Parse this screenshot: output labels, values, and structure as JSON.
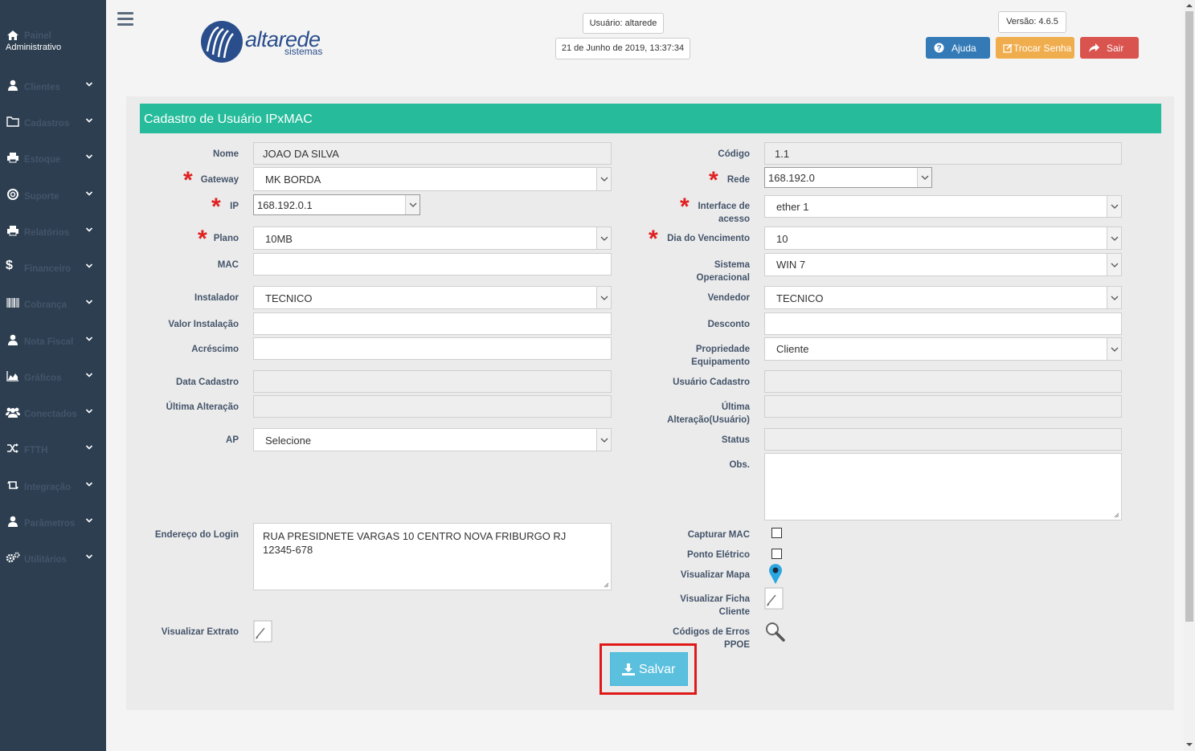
{
  "sidebar": {
    "home": {
      "line1": "Painel",
      "line2": "Administrativo"
    },
    "items": [
      {
        "label": "Clientes",
        "icon": "user-icon"
      },
      {
        "label": "Cadastros",
        "icon": "folder-icon"
      },
      {
        "label": "Estoque",
        "icon": "printer-icon"
      },
      {
        "label": "Suporte",
        "icon": "lifebuoy-icon"
      },
      {
        "label": "Relatórios",
        "icon": "printer-icon"
      },
      {
        "label": "Financeiro",
        "icon": "dollar-icon"
      },
      {
        "label": "Cobrança",
        "icon": "barcode-icon"
      },
      {
        "label": "Nota Fiscal",
        "icon": "user-icon"
      },
      {
        "label": "Gráficos",
        "icon": "area-chart-icon"
      },
      {
        "label": "Conectados",
        "icon": "users-icon"
      },
      {
        "label": "FTTH",
        "icon": "random-icon"
      },
      {
        "label": "Integração",
        "icon": "retweet-icon"
      },
      {
        "label": "Parâmetros",
        "icon": "user-icon"
      },
      {
        "label": "Utilitários",
        "icon": "cogs-icon"
      }
    ]
  },
  "header": {
    "logo_text": "altarede",
    "logo_sub": "sistemas",
    "user": "Usuário: altarede",
    "datetime": "21 de Junho de 2019, 13:37:34",
    "version": "Versão: 4.6.5",
    "help_label": "Ajuda",
    "change_pwd_label": "Trocar Senha",
    "logout_label": "Sair",
    "colors": {
      "help": "#337ab7",
      "change_pwd": "#f0ad4e",
      "logout": "#d9534f"
    }
  },
  "form": {
    "title": "Cadastro de Usuário IPxMAC",
    "nome": {
      "label": "Nome",
      "value": "JOAO DA SILVA"
    },
    "codigo": {
      "label": "Código",
      "value": "1.1"
    },
    "gateway": {
      "label": "Gateway",
      "value": "MK BORDA"
    },
    "rede": {
      "label": "Rede",
      "value": "168.192.0"
    },
    "ip": {
      "label": "IP",
      "value": "168.192.0.1"
    },
    "interface": {
      "label1": "Interface de",
      "label2": "acesso",
      "value": "ether 1"
    },
    "plano": {
      "label": "Plano",
      "value": "10MB"
    },
    "vencimento": {
      "label": "Dia do Vencimento",
      "value": "10"
    },
    "mac": {
      "label": "MAC",
      "value": ""
    },
    "so": {
      "label1": "Sistema",
      "label2": "Operacional",
      "value": "WIN 7"
    },
    "instalador": {
      "label": "Instalador",
      "value": "TECNICO"
    },
    "vendedor": {
      "label": "Vendedor",
      "value": "TECNICO"
    },
    "valor_instalacao": {
      "label": "Valor Instalação",
      "value": ""
    },
    "desconto": {
      "label": "Desconto",
      "value": ""
    },
    "acrescimo": {
      "label": "Acréscimo",
      "value": ""
    },
    "propriedade": {
      "label1": "Propriedade",
      "label2": "Equipamento",
      "value": "Cliente"
    },
    "data_cadastro": {
      "label": "Data Cadastro",
      "value": ""
    },
    "usuario_cadastro": {
      "label": "Usuário Cadastro",
      "value": ""
    },
    "ultima_alteracao": {
      "label": "Última Alteração",
      "value": ""
    },
    "ultima_alteracao_usuario": {
      "label1": "Última",
      "label2": "Alteração(Usuário)",
      "value": ""
    },
    "ap": {
      "label": "AP",
      "value": "Selecione"
    },
    "status": {
      "label": "Status",
      "value": ""
    },
    "obs": {
      "label": "Obs.",
      "value": ""
    },
    "endereco": {
      "label": "Endereço do Login",
      "line1": "RUA PRESIDNETE VARGAS 10 CENTRO NOVA FRIBURGO RJ",
      "line2": "12345-678"
    },
    "capturar_mac": {
      "label": "Capturar MAC"
    },
    "ponto_eletrico": {
      "label": "Ponto Elétrico"
    },
    "visualizar_mapa": {
      "label": "Visualizar Mapa"
    },
    "visualizar_ficha": {
      "label1": "Visualizar Ficha",
      "label2": "Cliente"
    },
    "codigos_erros": {
      "label1": "Códigos de Erros",
      "label2": "PPOE"
    },
    "visualizar_extrato": {
      "label": "Visualizar Extrato"
    },
    "save_label": "Salvar"
  }
}
